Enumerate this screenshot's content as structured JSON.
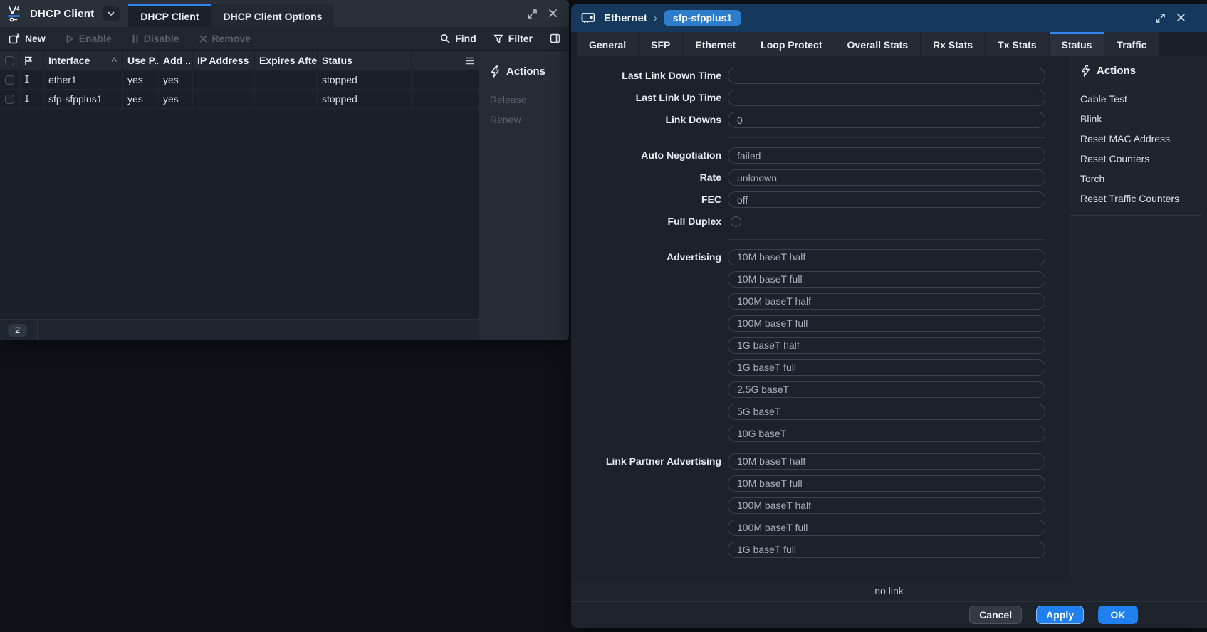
{
  "colors": {
    "accent_blue": "#2e86f0",
    "titlebar_navy": "#15395c",
    "pill_blue": "#2e7ccc",
    "button_blue": "#2080ef",
    "panel_bg": "#262c35",
    "disabled_text": "#59626f"
  },
  "icons": {
    "app_logo": "winbox-v4-logo",
    "title_dropdown": "chevron-down-icon",
    "new": "add-window-icon",
    "enable": "play-icon",
    "disable": "pause-icon",
    "remove": "cross-icon",
    "find": "magnifier-icon",
    "filter": "funnel-icon",
    "panel_toggle": "sidebar-toggle-icon",
    "flag_column": "flag-icon",
    "sort": "caret-up",
    "column_menu": "hamburger-icon",
    "actions": "lightning-bolt-icon",
    "ethernet": "network-card-icon",
    "maximize": "expand-arrows-icon",
    "close": "cross-icon"
  },
  "left_window": {
    "title": "DHCP Client",
    "tabs": [
      {
        "label": "DHCP Client",
        "active": true
      },
      {
        "label": "DHCP Client Options",
        "active": false
      }
    ],
    "toolbar": {
      "new": "New",
      "enable": "Enable",
      "disable": "Disable",
      "remove": "Remove",
      "find": "Find",
      "filter": "Filter"
    },
    "table": {
      "columns": {
        "interface": "Interface",
        "sort_caret": "^",
        "use_p": "Use P...",
        "add": "Add ...",
        "ip": "IP Address",
        "expires": "Expires After",
        "status": "Status"
      },
      "rows": [
        {
          "flag": "I",
          "interface": "ether1",
          "use_p": "yes",
          "add": "yes",
          "ip": "",
          "expires": "",
          "status": "stopped"
        },
        {
          "flag": "I",
          "interface": "sfp-sfpplus1",
          "use_p": "yes",
          "add": "yes",
          "ip": "",
          "expires": "",
          "status": "stopped"
        }
      ],
      "count": "2"
    },
    "actions": {
      "title": "Actions",
      "items": [
        {
          "label": "Release",
          "disabled": true
        },
        {
          "label": "Renew",
          "disabled": true
        }
      ]
    }
  },
  "right_window": {
    "breadcrumb": {
      "section": "Ethernet",
      "separator": "›",
      "item": "sfp-sfpplus1"
    },
    "tabs": [
      {
        "label": "General"
      },
      {
        "label": "SFP"
      },
      {
        "label": "Ethernet"
      },
      {
        "label": "Loop Protect"
      },
      {
        "label": "Overall Stats"
      },
      {
        "label": "Rx Stats"
      },
      {
        "label": "Tx Stats"
      },
      {
        "label": "Status",
        "active": true
      },
      {
        "label": "Traffic"
      }
    ],
    "form": {
      "last_link_down_time": {
        "label": "Last Link Down Time",
        "value": ""
      },
      "last_link_up_time": {
        "label": "Last Link Up Time",
        "value": ""
      },
      "link_downs": {
        "label": "Link Downs",
        "value": "0"
      },
      "auto_negotiation": {
        "label": "Auto Negotiation",
        "value": "failed"
      },
      "rate": {
        "label": "Rate",
        "value": "unknown"
      },
      "fec": {
        "label": "FEC",
        "value": "off"
      },
      "full_duplex": {
        "label": "Full Duplex",
        "checked": false
      },
      "advertising": {
        "label": "Advertising",
        "options": [
          "10M baseT half",
          "10M baseT full",
          "100M baseT half",
          "100M baseT full",
          "1G baseT half",
          "1G baseT full",
          "2.5G baseT",
          "5G baseT",
          "10G baseT"
        ]
      },
      "link_partner_advertising": {
        "label": "Link Partner Advertising",
        "options": [
          "10M baseT half",
          "10M baseT full",
          "100M baseT half",
          "100M baseT full",
          "1G baseT full"
        ]
      }
    },
    "actions": {
      "title": "Actions",
      "items": [
        {
          "label": "Cable Test"
        },
        {
          "label": "Blink"
        },
        {
          "label": "Reset MAC Address"
        },
        {
          "label": "Reset Counters"
        },
        {
          "label": "Torch"
        },
        {
          "label": "Reset Traffic Counters"
        }
      ]
    },
    "status_bar": {
      "text": "no link"
    },
    "buttons": {
      "cancel": "Cancel",
      "apply": "Apply",
      "ok": "OK"
    }
  }
}
